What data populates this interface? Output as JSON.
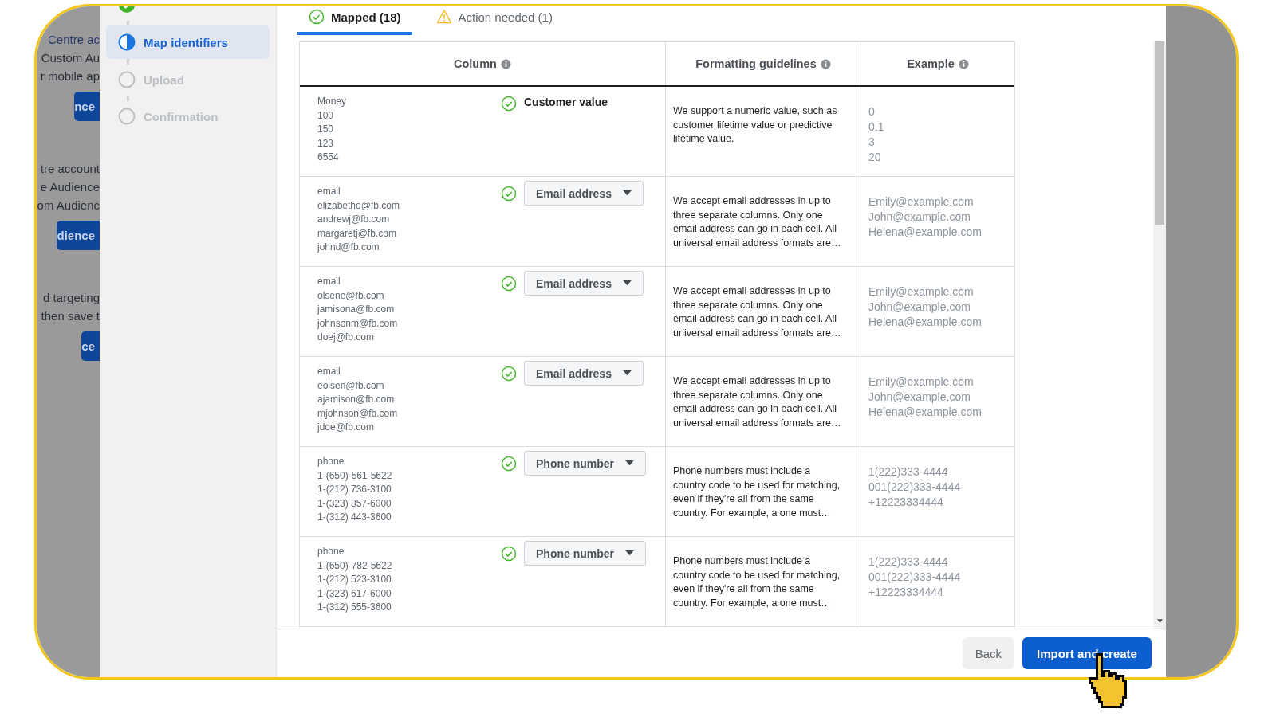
{
  "background_page": {
    "lines": [
      {
        "kind": "text",
        "text": "Centre ac"
      },
      {
        "kind": "text",
        "text": "Custom Au"
      },
      {
        "kind": "text",
        "text": "r mobile ap"
      },
      {
        "kind": "button",
        "text": "nce"
      },
      {
        "kind": "gap"
      },
      {
        "kind": "text",
        "text": "tre account"
      },
      {
        "kind": "text",
        "text": "e Audience"
      },
      {
        "kind": "text",
        "text": "om Audienc"
      },
      {
        "kind": "button",
        "text": "dience"
      },
      {
        "kind": "gap"
      },
      {
        "kind": "text",
        "text": "d targeting"
      },
      {
        "kind": "text",
        "text": "then save t"
      },
      {
        "kind": "button",
        "text": "ce"
      }
    ]
  },
  "steps": [
    {
      "completed": true,
      "selected": false
    },
    {
      "completed": false,
      "label": "Map identifiers",
      "selected": true
    },
    {
      "completed": false,
      "label": "Upload",
      "selected": false
    },
    {
      "completed": false,
      "label": "Confirmation",
      "selected": false
    }
  ],
  "tabs": [
    {
      "kind": "ok",
      "label": "Mapped (18)",
      "selected": true
    },
    {
      "kind": "warning",
      "label": "Action needed (1)",
      "selected": false
    }
  ],
  "table": {
    "columns": [
      "Column",
      "Formatting guidelines",
      "Example"
    ],
    "rows": [
      {
        "source": [
          "Money",
          "100",
          "150",
          "123",
          "6554"
        ],
        "mapping": {
          "kind": "label",
          "text": "Customer value"
        },
        "guideline": "We support a numeric value, such as customer lifetime value or predictive lifetime value.",
        "examples": [
          "0",
          "0.1",
          "3",
          "20"
        ]
      },
      {
        "source": [
          "email",
          "elizabetho@fb.com",
          "andrewj@fb.com",
          "margaretj@fb.com",
          "johnd@fb.com"
        ],
        "mapping": {
          "kind": "dropdown",
          "text": "Email address"
        },
        "guideline": "We accept email addresses in up to three separate columns. Only one email address can go in each cell. All universal email address formats are…",
        "examples": [
          "Emily@example.com",
          "John@example.com",
          "Helena@example.com"
        ]
      },
      {
        "source": [
          "email",
          "olsene@fb.com",
          "jamisona@fb.com",
          "johnsonm@fb.com",
          "doej@fb.com"
        ],
        "mapping": {
          "kind": "dropdown",
          "text": "Email address"
        },
        "guideline": "We accept email addresses in up to three separate columns. Only one email address can go in each cell. All universal email address formats are…",
        "examples": [
          "Emily@example.com",
          "John@example.com",
          "Helena@example.com"
        ]
      },
      {
        "source": [
          "email",
          "eolsen@fb.com",
          "ajamison@fb.com",
          "mjohnson@fb.com",
          "jdoe@fb.com"
        ],
        "mapping": {
          "kind": "dropdown",
          "text": "Email address"
        },
        "guideline": "We accept email addresses in up to three separate columns. Only one email address can go in each cell. All universal email address formats are…",
        "examples": [
          "Emily@example.com",
          "John@example.com",
          "Helena@example.com"
        ]
      },
      {
        "source": [
          "phone",
          "1-(650)-561-5622",
          "1-(212) 736-3100",
          "1-(323) 857-6000",
          "1-(312) 443-3600"
        ],
        "mapping": {
          "kind": "dropdown",
          "text": "Phone number"
        },
        "guideline": "Phone numbers must include a country code to be used for matching, even if they're all from the same country. For example, a one must…",
        "examples": [
          "1(222)333-4444",
          "001(222)333-4444",
          "+12223334444"
        ]
      },
      {
        "source": [
          "phone",
          "1-(650)-782-5622",
          "1-(212) 523-3100",
          "1-(323) 617-6000",
          "1-(312) 555-3600"
        ],
        "mapping": {
          "kind": "dropdown",
          "text": "Phone number"
        },
        "guideline": "Phone numbers must include a country code to be used for matching, even if they're all from the same country. For example, a one must…",
        "examples": [
          "1(222)333-4444",
          "001(222)333-4444",
          "+12223334444"
        ]
      }
    ]
  },
  "footer": {
    "buttons": [
      {
        "kind": "secondary",
        "label": "Back"
      },
      {
        "kind": "primary",
        "label": "Import and create"
      }
    ]
  }
}
